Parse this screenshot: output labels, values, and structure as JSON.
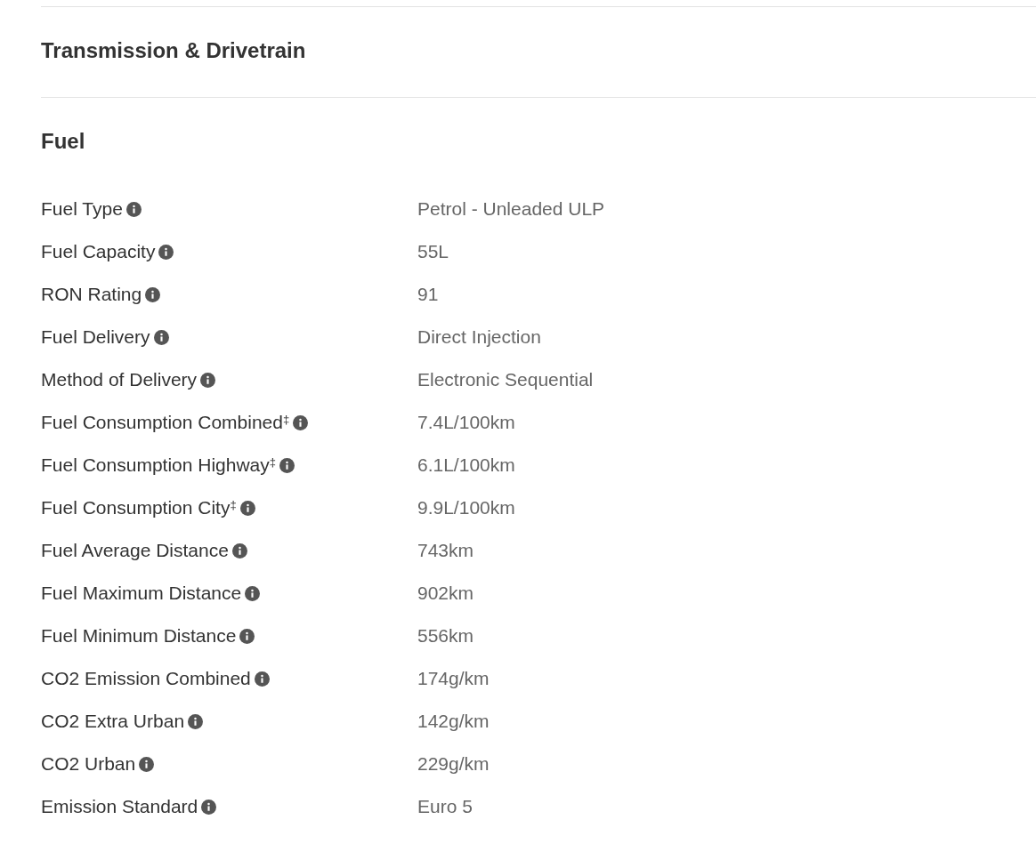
{
  "sections": [
    {
      "title": "Transmission & Drivetrain"
    },
    {
      "title": "Fuel",
      "rows": [
        {
          "label": "Fuel Type",
          "value": "Petrol - Unleaded ULP"
        },
        {
          "label": "Fuel Capacity",
          "value": "55L"
        },
        {
          "label": "RON Rating",
          "value": "91"
        },
        {
          "label": "Fuel Delivery",
          "value": "Direct Injection"
        },
        {
          "label": "Method of Delivery",
          "value": "Electronic Sequential"
        },
        {
          "label": "Fuel Consumption Combined$^{‡}$",
          "value": "7.4L/100km"
        },
        {
          "label": "Fuel Consumption Highway$^{‡}$",
          "value": "6.1L/100km"
        },
        {
          "label": "Fuel Consumption City$^{‡}$",
          "value": "9.9L/100km"
        },
        {
          "label": "Fuel Average Distance",
          "value": "743km"
        },
        {
          "label": "Fuel Maximum Distance",
          "value": "902km"
        },
        {
          "label": "Fuel Minimum Distance",
          "value": "556km"
        },
        {
          "label": "CO2 Emission Combined",
          "value": "174g/km"
        },
        {
          "label": "CO2 Extra Urban",
          "value": "142g/km"
        },
        {
          "label": "CO2 Urban",
          "value": "229g/km"
        },
        {
          "label": "Emission Standard",
          "value": "Euro 5"
        }
      ]
    }
  ]
}
